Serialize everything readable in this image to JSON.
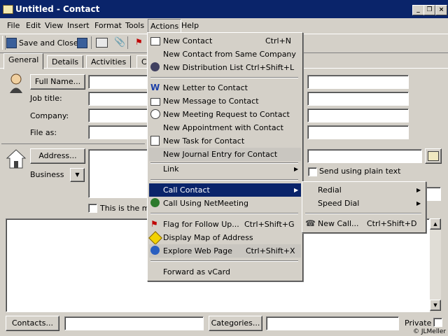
{
  "window": {
    "title": "Untitled - Contact"
  },
  "menubar": [
    "File",
    "Edit",
    "View",
    "Insert",
    "Format",
    "Tools",
    "Actions",
    "Help"
  ],
  "toolbar": {
    "save_close": "Save and Close"
  },
  "tabs": [
    "General",
    "Details",
    "Activities",
    "C"
  ],
  "form": {
    "full_name_btn": "Full Name...",
    "job_title": "Job title:",
    "company": "Company:",
    "file_as": "File as:",
    "address_btn": "Address...",
    "address_type": "Business",
    "this_is_mail": "This is the mai",
    "send_plain_text": "Send using plain text",
    "contacts_btn": "Contacts...",
    "categories_btn": "Categories...",
    "private": "Private"
  },
  "actions_menu": [
    {
      "label": "New Contact",
      "shortcut": "Ctrl+N",
      "icon": "new-contact-icon"
    },
    {
      "label": "New Contact from Same Company",
      "shortcut": "",
      "icon": ""
    },
    {
      "label": "New Distribution List",
      "shortcut": "Ctrl+Shift+L",
      "icon": "distribution-list-icon"
    },
    {
      "label": "New Letter to Contact",
      "shortcut": "",
      "icon": "word-icon"
    },
    {
      "label": "New Message to Contact",
      "shortcut": "",
      "icon": "message-icon"
    },
    {
      "label": "New Meeting Request to Contact",
      "shortcut": "",
      "icon": "meeting-icon"
    },
    {
      "label": "New Appointment with Contact",
      "shortcut": "",
      "icon": ""
    },
    {
      "label": "New Task for Contact",
      "shortcut": "",
      "icon": "task-icon"
    },
    {
      "label": "New Journal Entry for Contact",
      "shortcut": "",
      "icon": ""
    },
    {
      "label": "Link",
      "shortcut": "",
      "icon": "",
      "submenu": true
    },
    {
      "label": "Call Contact",
      "shortcut": "",
      "icon": "",
      "submenu": true
    },
    {
      "label": "Call Using NetMeeting",
      "shortcut": "",
      "icon": "netmeeting-icon"
    },
    {
      "label": "Flag for Follow Up...",
      "shortcut": "Ctrl+Shift+G",
      "icon": "flag-icon"
    },
    {
      "label": "Display Map of Address",
      "shortcut": "",
      "icon": "map-icon"
    },
    {
      "label": "Explore Web Page",
      "shortcut": "Ctrl+Shift+X",
      "icon": "web-icon"
    },
    {
      "label": "Forward as vCard",
      "shortcut": "",
      "icon": ""
    }
  ],
  "call_submenu": [
    {
      "label": "Redial",
      "shortcut": "",
      "submenu": true
    },
    {
      "label": "Speed Dial",
      "shortcut": "",
      "submenu": true
    },
    {
      "label": "New Call...",
      "shortcut": "Ctrl+Shift+D",
      "icon": "phone-icon"
    }
  ],
  "copyright": "© JLMeller"
}
